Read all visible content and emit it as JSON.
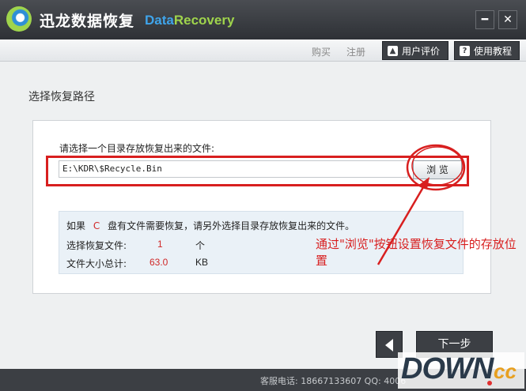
{
  "window": {
    "app_name": "迅龙数据恢复",
    "brand_en_part1": "Data",
    "brand_en_part2": "Recovery",
    "minimize_glyph": "━",
    "close_glyph": "✕"
  },
  "menubar": {
    "buy_label": "购买",
    "register_label": "注册",
    "rate_label": "用户评价",
    "tutorial_label": "使用教程",
    "rate_icon": "thumbs-up-icon",
    "tutorial_icon": "book-icon"
  },
  "page": {
    "section_title": "选择恢复路径",
    "prompt": "请选择一个目录存放恢复出来的文件:",
    "path_value": "E:\\KDR\\$Recycle.Bin",
    "browse_label": "浏 览",
    "info": {
      "line_prefix": "如果",
      "drive_letter": "C",
      "line_suffix": "盘有文件需要恢复，请另外选择目录存放恢复出来的文件。",
      "selected_label": "选择恢复文件:",
      "selected_value": "1",
      "selected_unit": "个",
      "size_label": "文件大小总计:",
      "size_value": "63.0",
      "size_unit": "KB"
    },
    "annotation": "通过\"浏览\"按钮设置恢复文件的存放位置"
  },
  "nav": {
    "next_label": "下一步"
  },
  "footer": {
    "contact_text": "客服电话: 18667133607 QQ: 4006"
  },
  "watermark": {
    "main": "DOWN",
    "suffix": "cc"
  },
  "colors": {
    "annotation_red": "#d81f1f",
    "brand_blue": "#3fa4ea",
    "brand_green": "#9fd44c",
    "dark_button": "#3c3f44"
  }
}
